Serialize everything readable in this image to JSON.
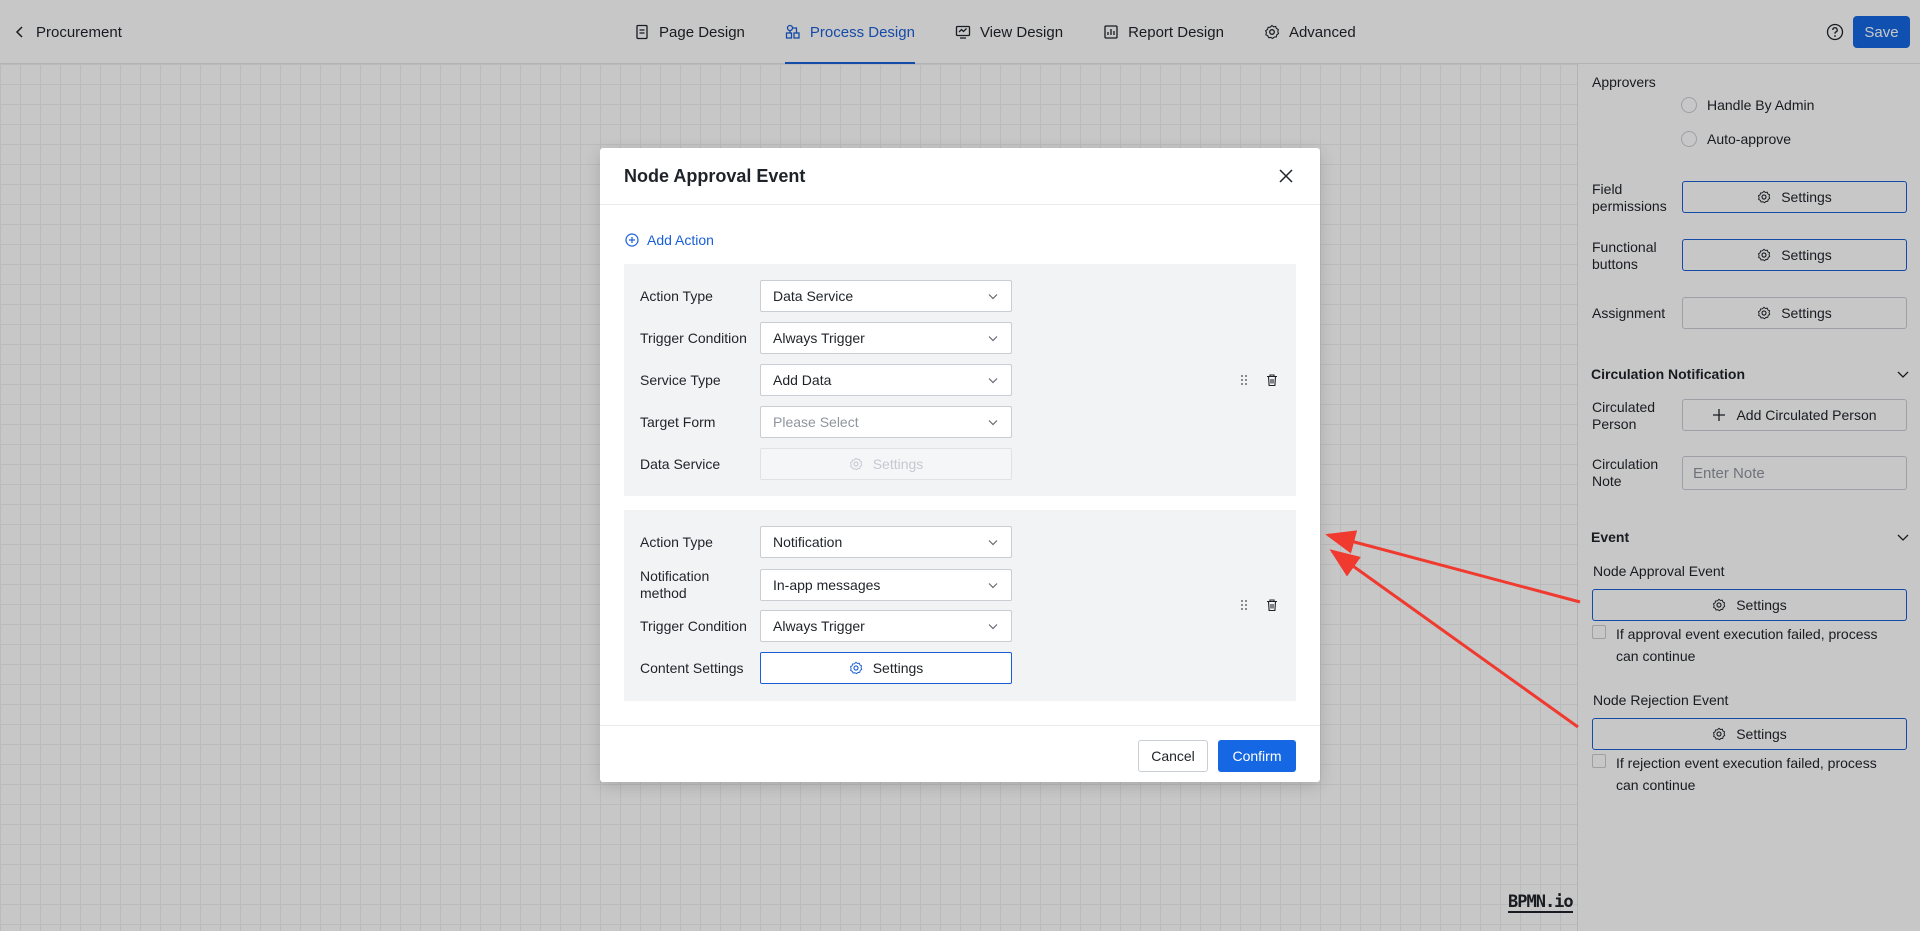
{
  "header": {
    "back_label": "Procurement",
    "tabs": [
      {
        "label": "Page Design",
        "icon": "page-icon"
      },
      {
        "label": "Process Design",
        "icon": "process-icon",
        "active": true
      },
      {
        "label": "View Design",
        "icon": "view-icon"
      },
      {
        "label": "Report Design",
        "icon": "report-icon"
      },
      {
        "label": "Advanced",
        "icon": "gear-icon"
      }
    ],
    "save_label": "Save"
  },
  "canvas": {
    "watermark": "BPMN.io"
  },
  "panel": {
    "approvers_label": "Approvers",
    "radio_options": [
      "Handle By Admin",
      "Auto-approve"
    ],
    "field_permissions": {
      "label_line1": "Field",
      "label_line2": "permissions",
      "button": "Settings"
    },
    "functional_buttons": {
      "label_line1": "Functional",
      "label_line2": "buttons",
      "button": "Settings"
    },
    "assignment": {
      "label": "Assignment",
      "button": "Settings"
    },
    "circulation_section": "Circulation Notification",
    "circulated_person": {
      "label_line1": "Circulated",
      "label_line2": "Person",
      "button": "Add Circulated Person"
    },
    "circulation_note": {
      "label_line1": "Circulation",
      "label_line2": "Note",
      "placeholder": "Enter Note"
    },
    "event_section": "Event",
    "approval_event": {
      "label": "Node Approval Event",
      "button": "Settings",
      "checkbox": "If approval event execution failed, process can continue"
    },
    "rejection_event": {
      "label": "Node Rejection Event",
      "button": "Settings",
      "checkbox": "If rejection event execution failed, process can continue"
    }
  },
  "modal": {
    "title": "Node Approval Event",
    "add_action": "Add Action",
    "card1": {
      "action_type": {
        "label": "Action Type",
        "value": "Data Service"
      },
      "trigger_condition": {
        "label": "Trigger Condition",
        "value": "Always Trigger"
      },
      "service_type": {
        "label": "Service Type",
        "value": "Add Data"
      },
      "target_form": {
        "label": "Target Form",
        "placeholder": "Please Select"
      },
      "data_service": {
        "label": "Data Service",
        "button": "Settings"
      }
    },
    "card2": {
      "action_type": {
        "label": "Action Type",
        "value": "Notification"
      },
      "notification_method": {
        "label_line1": "Notification",
        "label_line2": "method",
        "value": "In-app messages"
      },
      "trigger_condition": {
        "label": "Trigger Condition",
        "value": "Always Trigger"
      },
      "content_settings": {
        "label": "Content Settings",
        "button": "Settings"
      }
    },
    "cancel_label": "Cancel",
    "confirm_label": "Confirm"
  },
  "colors": {
    "accent": "#1567e3",
    "annotation_arrow": "#f03a2f"
  }
}
